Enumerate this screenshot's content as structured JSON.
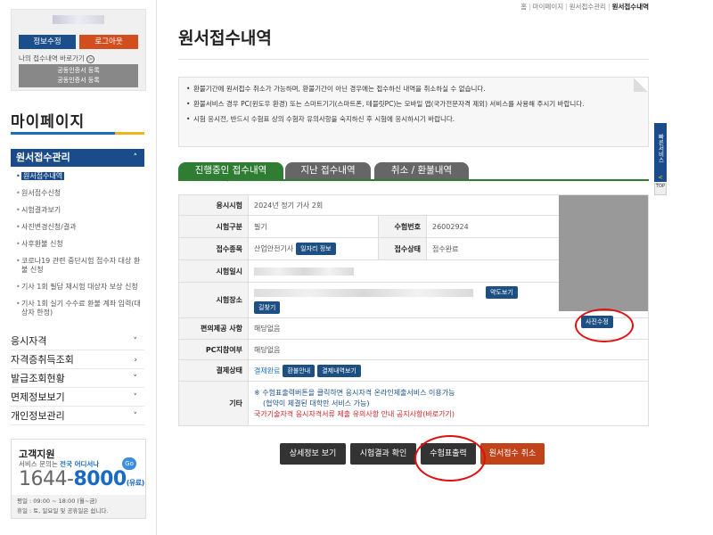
{
  "sidebar": {
    "buttons": {
      "info": "정보수정",
      "logout": "로그아웃"
    },
    "shortcut": "나의 접수내역 바로가기",
    "shortcut_icon": ">",
    "cert_lines": [
      "공동인증서 등록",
      "공동인증서 등록"
    ],
    "title": "마이페이지",
    "active_menu": "원서접수관리",
    "sub_items": [
      "원서접수내역",
      "원서접수신청",
      "시험결과보기",
      "사진변경신청/결과",
      "사후환불 신청",
      "코로나19 관련 중단시험 접수자 대상 환불 신청",
      "기사 1회 필답 재시험 대상자 보상 신청",
      "기사 1회 실기 수수료 환불 계좌 입력(대상자 한정)"
    ],
    "menus": [
      "응시자격",
      "자격증취득조회",
      "발급조회현황",
      "면제정보보기",
      "개인정보관리"
    ],
    "cs": {
      "title": "고객지원",
      "subtitle_prefix": "서비스 문의는 ",
      "subtitle_highlight": "전국 어디서나",
      "go": "Go",
      "phone_a": "1644",
      "phone_b": "8000",
      "phone_suffix": "(유료)",
      "hours1": "평일 : 09:00 ~ 18:00 (월~금)",
      "hours2": "휴일 : 토, 일요일 및 공휴일은 쉽니다."
    }
  },
  "breadcrumb": {
    "home": "홈",
    "b1": "마이페이지",
    "b2": "원서접수관리",
    "current": "원서접수내역"
  },
  "page_title": "원서접수내역",
  "notices": [
    "환불기간에 원서접수 취소가 가능하며, 환불기간이 아닌 경우에는 접수하신 내역을 취소하실 수 없습니다.",
    "환불서비스 경우 PC(윈도우 환경) 또는 스마트기기(스마트폰, 테블릿PC)는 모바일 앱(국가전문자격 제외) 서비스를 사용해 주시기 바랍니다.",
    "시험 응시전, 반드시 수험표 상의 수험자 유의사항을 숙지하신 후 시험에 응시하시기 바랍니다."
  ],
  "tabs": [
    "진행중인 접수내역",
    "지난 접수내역",
    "취소 / 환불내역"
  ],
  "table": {
    "exam_session_label": "응시시험",
    "exam_session": "2024년 정기 기사 2회",
    "exam_type_label": "시험구분",
    "exam_type": "필기",
    "exam_no_label": "수험번호",
    "exam_no": "26002924",
    "item_label": "접수종목",
    "item": "산업안전기사",
    "job_btn": "일자리 정보",
    "status_label": "접수상태",
    "status": "접수완료",
    "date_label": "시험일시",
    "place_label": "시험장소",
    "map_btn": "약도보기",
    "route_btn": "길찾기",
    "convenience_label": "편의제공 사항",
    "convenience": "해당없음",
    "pc_label": "PC지참여부",
    "pc": "해당없음",
    "payment_label": "결제상태",
    "payment": "결제완료",
    "pay_guide_btn": "환불안내",
    "pay_detail_btn": "결제내역보기",
    "etc_label": "기타",
    "etc1": "※ 수험표출력버튼을 클릭하면 응시자격 온라인제출서비스 이용가능",
    "etc2": "(협약이 체결된 대학만 서비스 가능)",
    "etc3": "국가기술자격 응시자격서류 제출 유의사항 안내 공지사항(바로가기)"
  },
  "photo_btn": "사진수정",
  "bottom_buttons": [
    "상세정보 보기",
    "시험결과 확인",
    "수험표출력",
    "원서접수 취소"
  ],
  "quick_menu": {
    "label": "빠른서비스",
    "arrow": "<",
    "top": "TOP"
  },
  "icons": {
    "chevron_up": "˄",
    "chevron_down": "˅",
    "chevron_right": "›",
    "tab_arrow": "˅"
  }
}
